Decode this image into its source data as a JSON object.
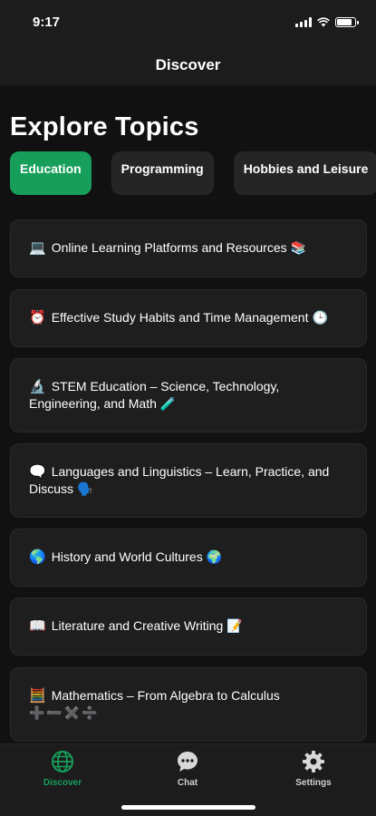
{
  "status_bar": {
    "time": "9:17"
  },
  "header": {
    "title": "Discover"
  },
  "section": {
    "title": "Explore Topics"
  },
  "chips": [
    {
      "label": "Education",
      "active": true
    },
    {
      "label": "Programming",
      "active": false
    },
    {
      "label": "Hobbies and Leisure",
      "active": false
    }
  ],
  "topics": [
    {
      "icon": "💻",
      "label": "Online Learning Platforms and Resources",
      "end_icon": "📚"
    },
    {
      "icon": "⏰",
      "label": "Effective Study Habits and Time Management",
      "end_icon": "🕒"
    },
    {
      "icon": "🔬",
      "label": "STEM Education – Science, Technology, Engineering, and Math",
      "end_icon": "🧪"
    },
    {
      "icon": "🗨️",
      "label": "Languages and Linguistics – Learn, Practice, and Discuss",
      "end_icon": "🗣️"
    },
    {
      "icon": "🌎",
      "label": "History and World Cultures",
      "end_icon": "🌍"
    },
    {
      "icon": "📖",
      "label": "Literature and Creative Writing",
      "end_icon": "📝"
    },
    {
      "icon": "🧮",
      "label": "Mathematics – From Algebra to Calculus",
      "end_icon": "➕➖✖️➗"
    }
  ],
  "tabbar": {
    "discover_label": "Discover",
    "chat_label": "Chat",
    "settings_label": "Settings"
  },
  "colors": {
    "accent": "#179e5a",
    "background": "#111111",
    "card": "#1e1e1e"
  }
}
